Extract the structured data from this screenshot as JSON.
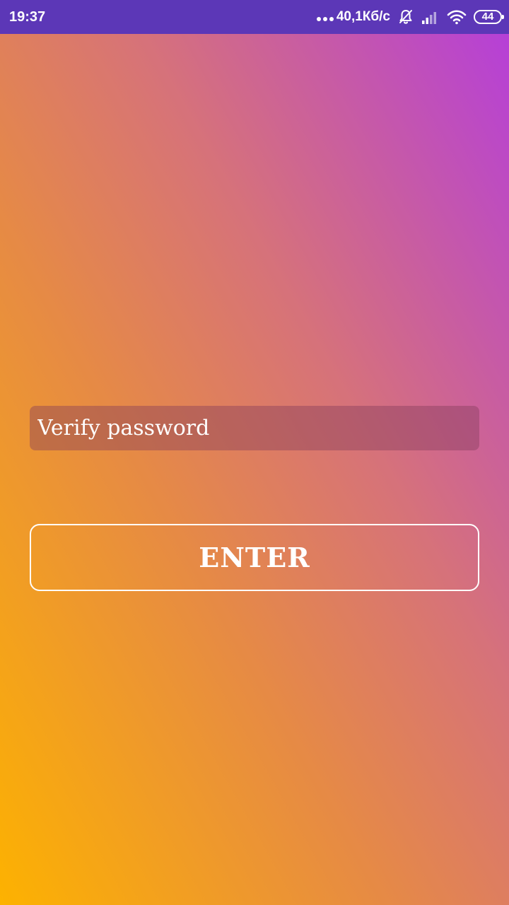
{
  "status_bar": {
    "time": "19:37",
    "network_speed": "40,1Кб/с",
    "battery_level": "44",
    "icons": [
      "more-dots-icon",
      "bell-off-icon",
      "cell-signal-icon",
      "wifi-icon",
      "battery-icon"
    ]
  },
  "form": {
    "password_placeholder": "Verify password",
    "password_value": "",
    "enter_label": "ENTER"
  },
  "colors": {
    "status_bar": "#5c37b7",
    "gradient_bottom_left": "#fdb200",
    "gradient_top_right": "#b43ddc",
    "text": "#ffffff"
  }
}
